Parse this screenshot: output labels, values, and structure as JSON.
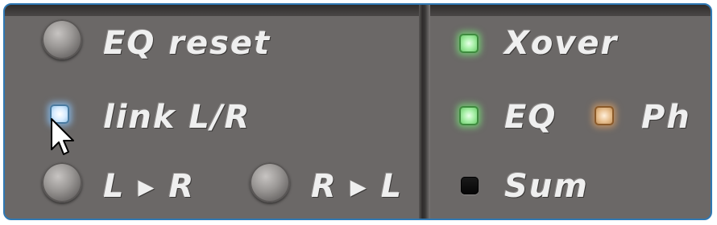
{
  "left_panel": {
    "eq_reset_label": "EQ reset",
    "link_lr_label": "link L/R",
    "l_to_r_label": "L ▸ R",
    "r_to_l_label": "R ▸ L"
  },
  "right_panel": {
    "xover_label": "Xover",
    "eq_label": "EQ",
    "ph_label": "Ph",
    "sum_label": "Sum"
  },
  "leds": {
    "link_lr": {
      "state": "on",
      "color": "#cfe6ff"
    },
    "xover": {
      "state": "on",
      "color": "#8fe08f"
    },
    "eq": {
      "state": "on",
      "color": "#8fe08f"
    },
    "ph": {
      "state": "on",
      "color": "#e8b888"
    },
    "sum": {
      "state": "off",
      "color": "#111111"
    }
  },
  "colors": {
    "panel_bg": "#6b6867",
    "label_text": "#efefef",
    "border": "#2f78b3"
  },
  "icons": [
    "knob-button",
    "led-indicator",
    "mouse-pointer-icon"
  ]
}
